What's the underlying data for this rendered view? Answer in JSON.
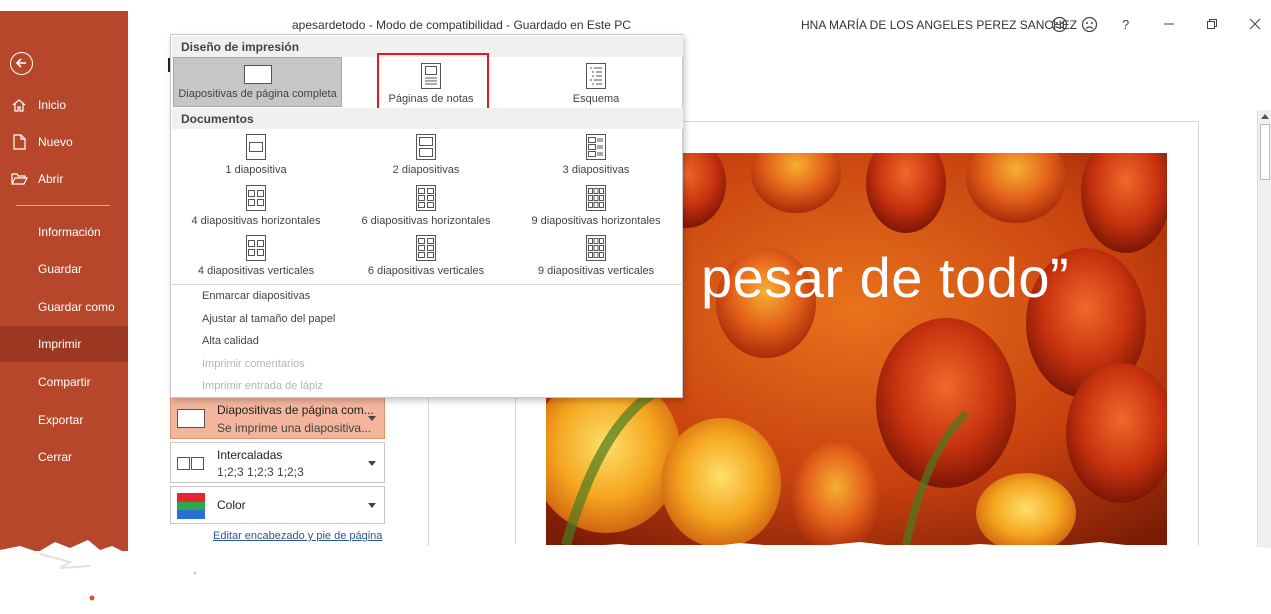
{
  "titlebar": {
    "document_title": "apesardetodo  -  Modo de compatibilidad  -  Guardado en Este PC",
    "user_name": "HNA MARÍA DE LOS ANGELES PEREZ SANCHEZ",
    "help": "?"
  },
  "sidebar": {
    "items": [
      {
        "label": "Inicio"
      },
      {
        "label": "Nuevo"
      },
      {
        "label": "Abrir"
      },
      {
        "label": "Información"
      },
      {
        "label": "Guardar"
      },
      {
        "label": "Guardar como"
      },
      {
        "label": "Imprimir",
        "active": true
      },
      {
        "label": "Compartir"
      },
      {
        "label": "Exportar"
      },
      {
        "label": "Cerrar"
      }
    ]
  },
  "layout_panel": {
    "section_print_layout": "Diseño de impresión",
    "print_layouts": [
      {
        "label": "Diapositivas de página completa",
        "icon": "full-page-slide-icon",
        "selected": true
      },
      {
        "label": "Páginas de notas",
        "icon": "notes-pages-icon",
        "highlighted": true
      },
      {
        "label": "Esquema",
        "icon": "outline-icon"
      }
    ],
    "section_handouts": "Documentos",
    "handouts": [
      {
        "label": "1 diapositiva",
        "icon": "handout-1-icon"
      },
      {
        "label": "2 diapositivas",
        "icon": "handout-2-icon"
      },
      {
        "label": "3 diapositivas",
        "icon": "handout-3-icon"
      },
      {
        "label": "4 diapositivas horizontales",
        "icon": "handout-4h-icon"
      },
      {
        "label": "6 diapositivas horizontales",
        "icon": "handout-6h-icon"
      },
      {
        "label": "9 diapositivas horizontales",
        "icon": "handout-9h-icon"
      },
      {
        "label": "4 diapositivas verticales",
        "icon": "handout-4v-icon"
      },
      {
        "label": "6 diapositivas verticales",
        "icon": "handout-6v-icon"
      },
      {
        "label": "9 diapositivas verticales",
        "icon": "handout-9v-icon"
      }
    ],
    "options": [
      {
        "label": "Enmarcar diapositivas",
        "enabled": true
      },
      {
        "label": "Ajustar al tamaño del papel",
        "enabled": true
      },
      {
        "label": "Alta calidad",
        "enabled": true
      },
      {
        "label": "Imprimir comentarios",
        "enabled": false
      },
      {
        "label": "Imprimir entrada de lápiz",
        "enabled": false
      }
    ]
  },
  "print_settings": {
    "layout": {
      "title": "Diapositivas de página com...",
      "subtitle": "Se imprime una diapositiva..."
    },
    "collation": {
      "title": "Intercaladas",
      "subtitle": "1;2;3    1;2;3    1;2;3"
    },
    "color": {
      "title": "Color"
    },
    "edit_header_footer": "Editar encabezado y pie de página"
  },
  "preview": {
    "slide_title": "pesar de todo”"
  },
  "colors": {
    "sidebar": "#b7472a",
    "sidebar_active": "#9c3822",
    "highlight": "#e8141e",
    "selected_setting": "#f3b59c"
  }
}
